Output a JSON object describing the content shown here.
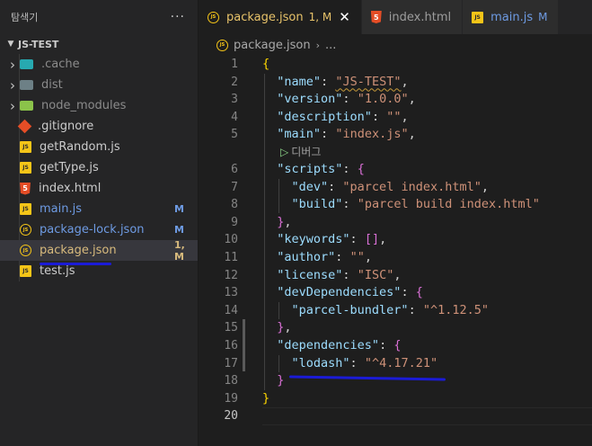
{
  "sidebar": {
    "title": "탐색기",
    "more": "···",
    "section": "JS-TEST",
    "items": [
      {
        "name": ".cache",
        "icon": "folder-cache-icon",
        "kind": "folder",
        "color": "#27a9b0",
        "dim": true,
        "badge": ""
      },
      {
        "name": "dist",
        "icon": "folder-dist-icon",
        "kind": "folder",
        "color": "#6d8086",
        "dim": true,
        "badge": ""
      },
      {
        "name": "node_modules",
        "icon": "folder-node-icon",
        "kind": "folder",
        "color": "#8bc34a",
        "dim": true,
        "badge": ""
      },
      {
        "name": ".gitignore",
        "icon": "git-icon",
        "kind": "git",
        "badge": ""
      },
      {
        "name": "getRandom.js",
        "icon": "js-file-icon",
        "kind": "js",
        "badge": ""
      },
      {
        "name": "getType.js",
        "icon": "js-file-icon",
        "kind": "js",
        "badge": ""
      },
      {
        "name": "index.html",
        "icon": "html-file-icon",
        "kind": "html",
        "badge": ""
      },
      {
        "name": "main.js",
        "icon": "js-file-icon",
        "kind": "js",
        "state": "modified",
        "badge": "M"
      },
      {
        "name": "package-lock.json",
        "icon": "json-file-icon",
        "kind": "json",
        "state": "modified",
        "badge": "M"
      },
      {
        "name": "package.json",
        "icon": "json-file-icon",
        "kind": "json",
        "state": "warn",
        "badge": "1, M",
        "selected": true
      },
      {
        "name": "test.js",
        "icon": "js-file-icon",
        "kind": "js",
        "badge": ""
      }
    ]
  },
  "tabs": [
    {
      "label": "package.json",
      "state": "1, M",
      "close": "✕",
      "icon": "json-file-icon",
      "kind": "json",
      "active": true
    },
    {
      "label": "index.html",
      "state": "",
      "icon": "html-file-icon",
      "kind": "html",
      "active": false
    },
    {
      "label": "main.js",
      "state": "M",
      "icon": "js-file-icon",
      "kind": "js",
      "active": false
    }
  ],
  "breadcrumb": {
    "file": "package.json",
    "sep": "›",
    "rest": "..."
  },
  "editor": {
    "line_numbers": [
      "1",
      "2",
      "3",
      "4",
      "5",
      "6",
      "7",
      "8",
      "9",
      "10",
      "11",
      "12",
      "13",
      "14",
      "15",
      "16",
      "17",
      "18",
      "19",
      "20"
    ],
    "codelens": "디버그",
    "codelens_glyph": "▷",
    "lines": [
      [
        [
          "b1",
          "{"
        ]
      ],
      [
        [
          "p",
          "  "
        ],
        [
          "k",
          "\"name\""
        ],
        [
          "p",
          ": "
        ],
        [
          "s squig",
          "\"JS-TEST\""
        ],
        [
          "p",
          ","
        ]
      ],
      [
        [
          "p",
          "  "
        ],
        [
          "k",
          "\"version\""
        ],
        [
          "p",
          ": "
        ],
        [
          "s",
          "\"1.0.0\""
        ],
        [
          "p",
          ","
        ]
      ],
      [
        [
          "p",
          "  "
        ],
        [
          "k",
          "\"description\""
        ],
        [
          "p",
          ": "
        ],
        [
          "s",
          "\"\""
        ],
        [
          "p",
          ","
        ]
      ],
      [
        [
          "p",
          "  "
        ],
        [
          "k",
          "\"main\""
        ],
        [
          "p",
          ": "
        ],
        [
          "s",
          "\"index.js\""
        ],
        [
          "p",
          ","
        ]
      ],
      [
        [
          "p",
          "  "
        ],
        [
          "k",
          "\"scripts\""
        ],
        [
          "p",
          ": "
        ],
        [
          "b2",
          "{"
        ]
      ],
      [
        [
          "p",
          "    "
        ],
        [
          "k",
          "\"dev\""
        ],
        [
          "p",
          ": "
        ],
        [
          "s",
          "\"parcel index.html\""
        ],
        [
          "p",
          ","
        ]
      ],
      [
        [
          "p",
          "    "
        ],
        [
          "k",
          "\"build\""
        ],
        [
          "p",
          ": "
        ],
        [
          "s",
          "\"parcel build index.html\""
        ]
      ],
      [
        [
          "p",
          "  "
        ],
        [
          "b2",
          "}"
        ],
        [
          "p",
          ","
        ]
      ],
      [
        [
          "p",
          "  "
        ],
        [
          "k",
          "\"keywords\""
        ],
        [
          "p",
          ": "
        ],
        [
          "b2",
          "[]"
        ],
        [
          "p",
          ","
        ]
      ],
      [
        [
          "p",
          "  "
        ],
        [
          "k",
          "\"author\""
        ],
        [
          "p",
          ": "
        ],
        [
          "s",
          "\"\""
        ],
        [
          "p",
          ","
        ]
      ],
      [
        [
          "p",
          "  "
        ],
        [
          "k",
          "\"license\""
        ],
        [
          "p",
          ": "
        ],
        [
          "s",
          "\"ISC\""
        ],
        [
          "p",
          ","
        ]
      ],
      [
        [
          "p",
          "  "
        ],
        [
          "k",
          "\"devDependencies\""
        ],
        [
          "p",
          ": "
        ],
        [
          "b2",
          "{"
        ]
      ],
      [
        [
          "p",
          "    "
        ],
        [
          "k",
          "\"parcel-bundler\""
        ],
        [
          "p",
          ": "
        ],
        [
          "s",
          "\"^1.12.5\""
        ]
      ],
      [
        [
          "p",
          "  "
        ],
        [
          "b2",
          "}"
        ],
        [
          "p",
          ","
        ]
      ],
      [
        [
          "p",
          "  "
        ],
        [
          "k",
          "\"dependencies\""
        ],
        [
          "p",
          ": "
        ],
        [
          "b2",
          "{"
        ]
      ],
      [
        [
          "p",
          "    "
        ],
        [
          "k",
          "\"lodash\""
        ],
        [
          "p",
          ": "
        ],
        [
          "s",
          "\"^4.17.21\""
        ]
      ],
      [
        [
          "p",
          "  "
        ],
        [
          "b2",
          "}"
        ]
      ],
      [
        [
          "b1",
          "}"
        ]
      ],
      []
    ]
  },
  "colors": {
    "accent_warn": "#e8c36a",
    "modified": "#6e9be3",
    "annotation": "#1b1bd6"
  }
}
